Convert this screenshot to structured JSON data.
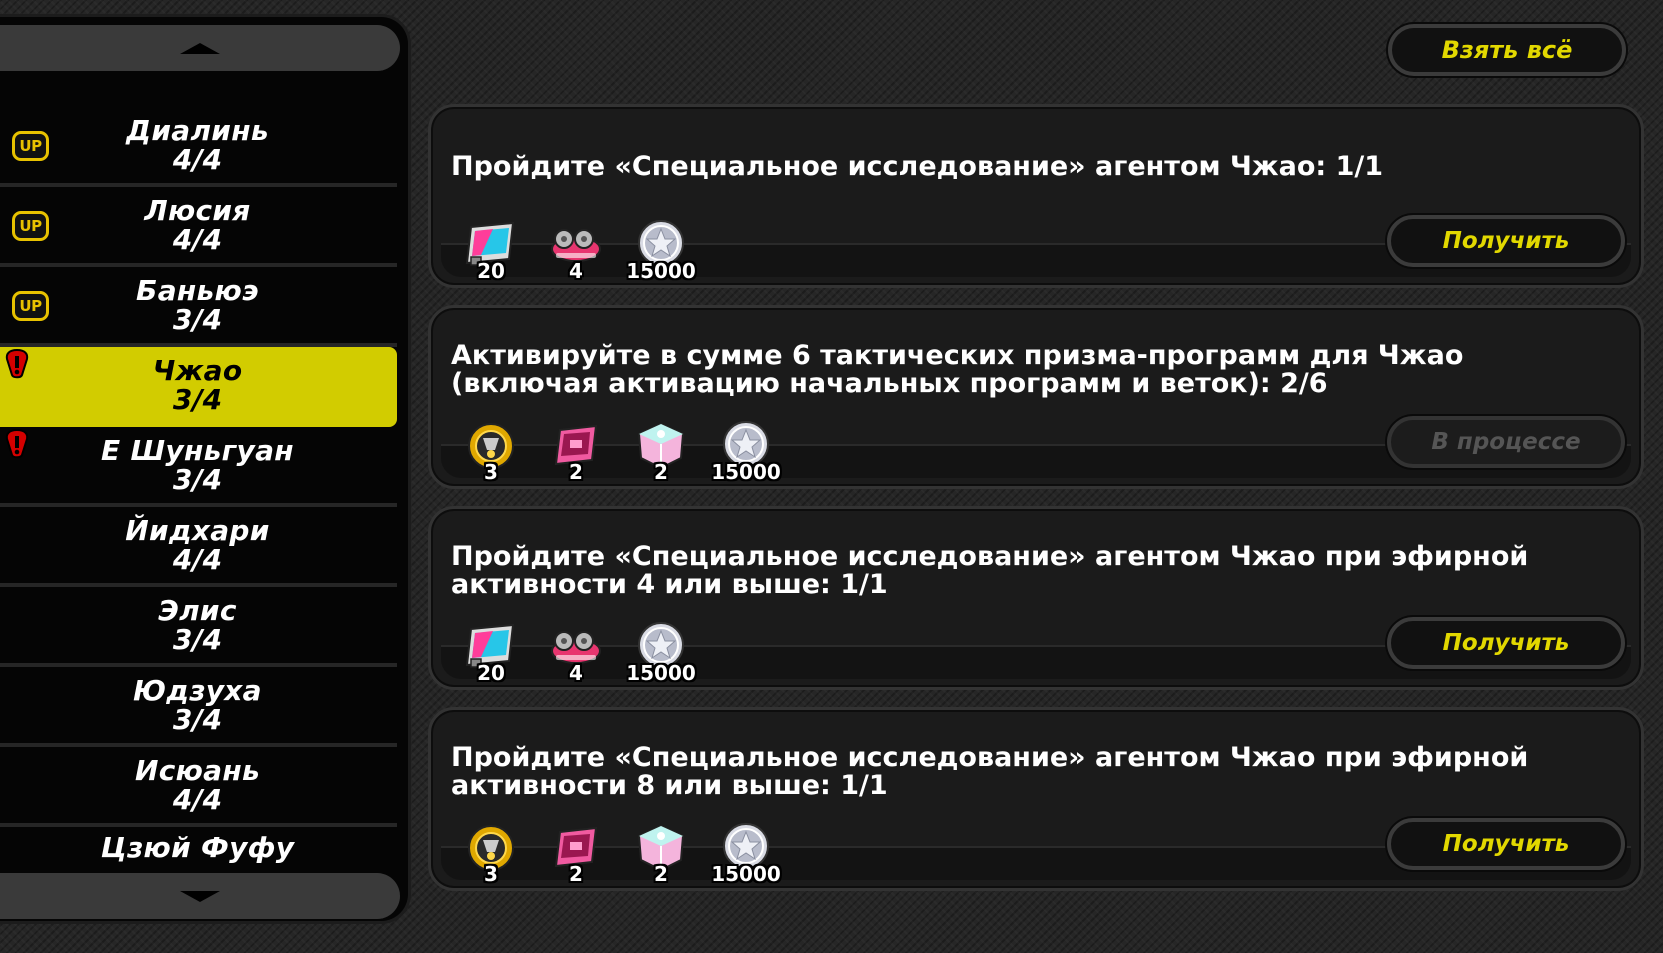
{
  "sidebar": {
    "agents": [
      {
        "name": "Диалинь",
        "count": "4/4",
        "badge": "UP"
      },
      {
        "name": "Люсия",
        "count": "4/4",
        "badge": "UP"
      },
      {
        "name": "Баньюэ",
        "count": "3/4",
        "badge": "UP"
      },
      {
        "name": "Чжао",
        "count": "3/4",
        "badge": "warning",
        "selected": true
      },
      {
        "name": "Е Шуньгуан",
        "count": "3/4",
        "badge": "warning"
      },
      {
        "name": "Йидхари",
        "count": "4/4"
      },
      {
        "name": "Элис",
        "count": "3/4"
      },
      {
        "name": "Юдзуха",
        "count": "3/4"
      },
      {
        "name": "Исюань",
        "count": "4/4"
      },
      {
        "name": "Цзюй Фуфу",
        "count": ""
      }
    ]
  },
  "header": {
    "take_all_label": "Взять всё"
  },
  "tasks": [
    {
      "text": "Пройдите «Специальное исследование» агентом Чжао: 1/1",
      "button": "Получить",
      "rewards": [
        {
          "icon": "film-ticket-icon",
          "qty": "20"
        },
        {
          "icon": "bangboo-car-icon",
          "qty": "4"
        },
        {
          "icon": "silver-coin-icon",
          "qty": "15000"
        }
      ]
    },
    {
      "text": "Активируйте в сумме 6 тактических призма-программ для Чжао (включая активацию начальных программ и веток): 2/6",
      "button": "В процессе",
      "rewards": [
        {
          "icon": "gold-gear-icon",
          "qty": "3"
        },
        {
          "icon": "pink-chip-icon",
          "qty": "2"
        },
        {
          "icon": "crystal-cube-icon",
          "qty": "2"
        },
        {
          "icon": "silver-coin-icon",
          "qty": "15000"
        }
      ]
    },
    {
      "text": "Пройдите «Специальное исследование» агентом Чжао при эфирной активности 4 или выше: 1/1",
      "button": "Получить",
      "rewards": [
        {
          "icon": "film-ticket-icon",
          "qty": "20"
        },
        {
          "icon": "bangboo-car-icon",
          "qty": "4"
        },
        {
          "icon": "silver-coin-icon",
          "qty": "15000"
        }
      ]
    },
    {
      "text": "Пройдите «Специальное исследование» агентом Чжао при эфирной активности 8 или выше: 1/1",
      "button": "Получить",
      "rewards": [
        {
          "icon": "gold-gear-icon",
          "qty": "3"
        },
        {
          "icon": "pink-chip-icon",
          "qty": "2"
        },
        {
          "icon": "crystal-cube-icon",
          "qty": "2"
        },
        {
          "icon": "silver-coin-icon",
          "qty": "15000"
        }
      ]
    }
  ],
  "colors": {
    "accent": "#d2cc00",
    "button_text": "#e2d800",
    "warning": "#d40000"
  }
}
